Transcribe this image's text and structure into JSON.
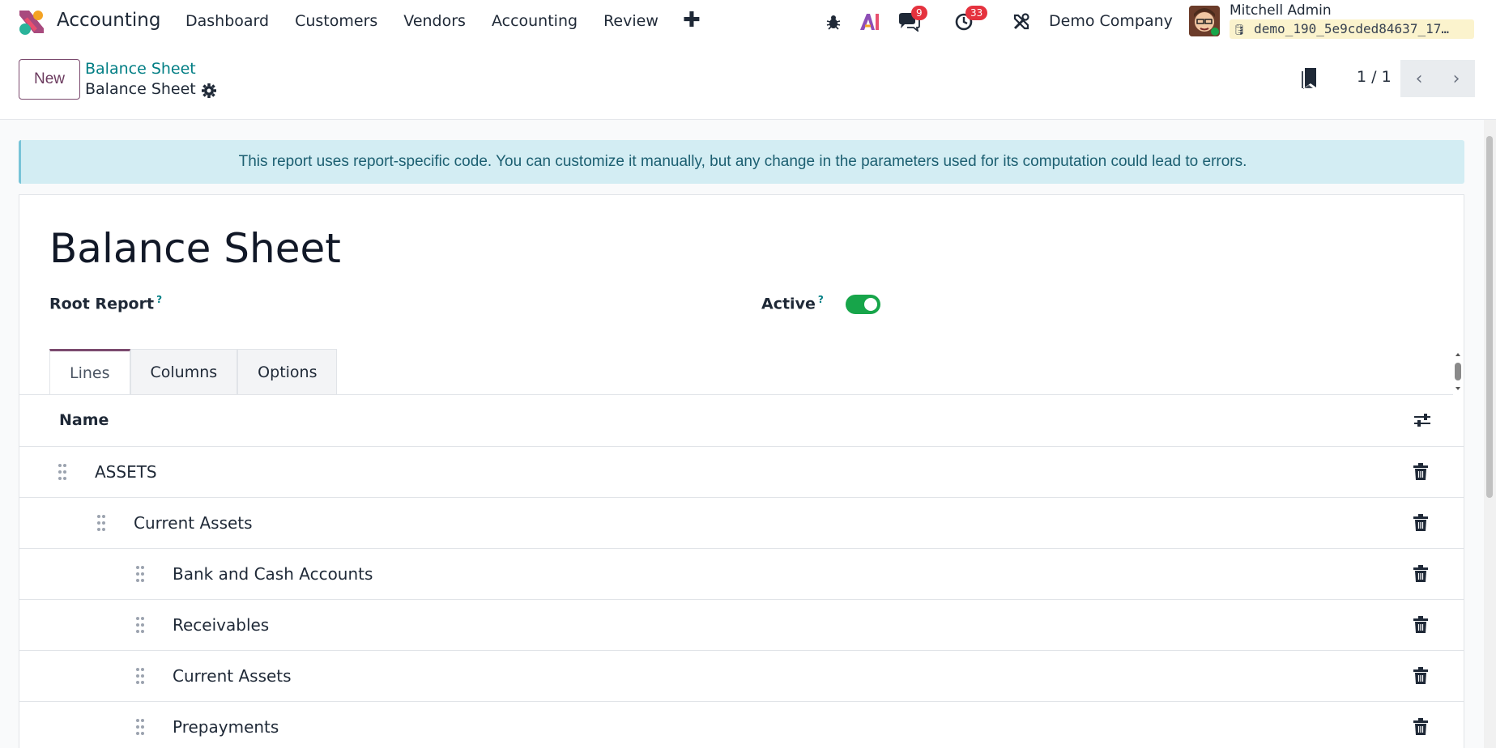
{
  "navbar": {
    "app_name": "Accounting",
    "menu": [
      "Dashboard",
      "Customers",
      "Vendors",
      "Accounting",
      "Review"
    ],
    "plus": "✚",
    "messages_count": "9",
    "activities_count": "33",
    "company": "Demo Company",
    "user_name": "Mitchell Admin",
    "database": "demo_190_5e9cded84637_17…"
  },
  "control_panel": {
    "new_label": "New",
    "breadcrumb_parent": "Balance Sheet",
    "breadcrumb_current": "Balance Sheet",
    "pager": "1 / 1"
  },
  "alert": {
    "text": "This report uses report-specific code. You can customize it manually, but any change in the parameters used for its computation could lead to errors."
  },
  "form": {
    "title": "Balance Sheet",
    "root_report_label": "Root Report",
    "active_label": "Active",
    "help_mark": "?",
    "active": true
  },
  "tabs": [
    "Lines",
    "Columns",
    "Options"
  ],
  "lines_table": {
    "header_name": "Name",
    "rows": [
      {
        "label": "ASSETS",
        "level": 0
      },
      {
        "label": "Current Assets",
        "level": 1
      },
      {
        "label": "Bank and Cash Accounts",
        "level": 2
      },
      {
        "label": "Receivables",
        "level": 2
      },
      {
        "label": "Current Assets",
        "level": 2
      },
      {
        "label": "Prepayments",
        "level": 2
      }
    ]
  },
  "colors": {
    "brand": "#7b4a6e",
    "link": "#017e84",
    "toggle_on": "#17a54a",
    "badge": "#e5323e",
    "alert_bg": "#d3edf3"
  }
}
